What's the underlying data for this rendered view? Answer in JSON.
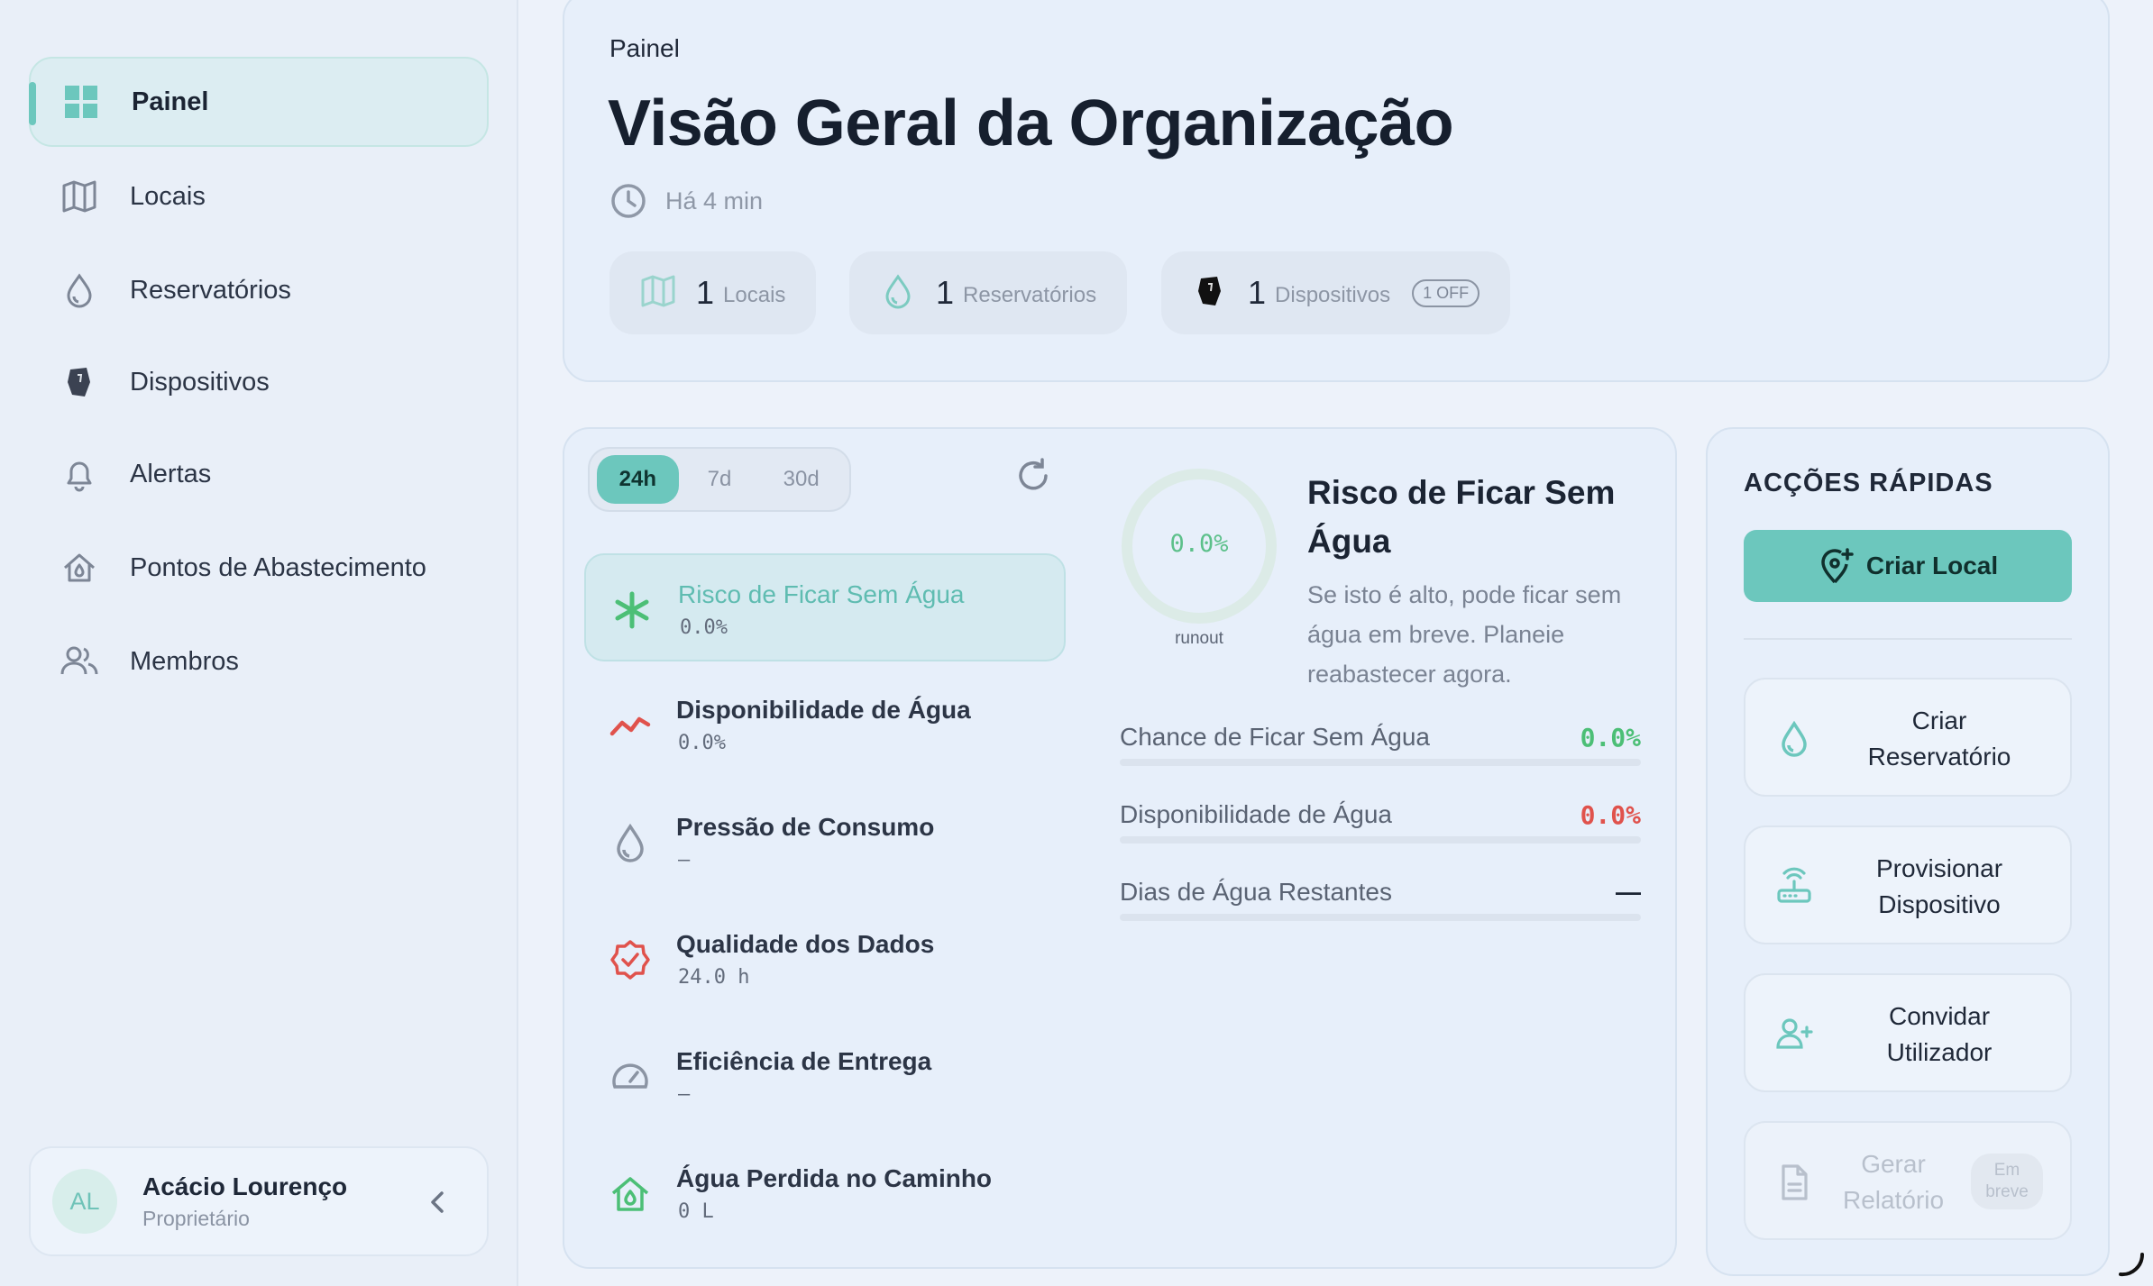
{
  "sidebar": {
    "items": [
      {
        "label": "Painel",
        "icon": "grid-icon",
        "active": true
      },
      {
        "label": "Locais",
        "icon": "map-icon"
      },
      {
        "label": "Reservatórios",
        "icon": "droplet-icon"
      },
      {
        "label": "Dispositivos",
        "icon": "device-icon"
      },
      {
        "label": "Alertas",
        "icon": "bell-icon"
      },
      {
        "label": "Pontos de Abastecimento",
        "icon": "house-icon"
      },
      {
        "label": "Membros",
        "icon": "users-icon"
      }
    ],
    "user": {
      "initials": "AL",
      "name": "Acácio Lourenço",
      "role": "Proprietário"
    }
  },
  "header": {
    "breadcrumb": "Painel",
    "title": "Visão Geral da Organização",
    "updated": "Há 4 min",
    "stats": [
      {
        "value": "1",
        "label": "Locais"
      },
      {
        "value": "1",
        "label": "Reservatórios"
      },
      {
        "value": "1",
        "label": "Dispositivos",
        "badge": "1 OFF"
      }
    ]
  },
  "metrics": {
    "ranges": [
      "24h",
      "7d",
      "30d"
    ],
    "selected_range": "24h",
    "items": [
      {
        "title": "Risco de Ficar Sem Água",
        "value": "0.0%",
        "icon": "asterisk-icon",
        "color": "#4cbf76"
      },
      {
        "title": "Disponibilidade de Água",
        "value": "0.0%",
        "icon": "trend-icon",
        "color": "#e0524c"
      },
      {
        "title": "Pressão de Consumo",
        "value": "—",
        "icon": "droplet-icon",
        "color": "#8b94a3"
      },
      {
        "title": "Qualidade dos Dados",
        "value": "24.0 h",
        "icon": "badge-check-icon",
        "color": "#e0524c"
      },
      {
        "title": "Eficiência de Entrega",
        "value": "—",
        "icon": "gauge-icon",
        "color": "#8b94a3"
      },
      {
        "title": "Água Perdida no Caminho",
        "value": "0 L",
        "icon": "house-drop-icon",
        "color": "#4cbf76"
      }
    ],
    "detail": {
      "gauge_value": "0.0%",
      "gauge_fraction": 0.0,
      "gauge_label": "runout",
      "title": "Risco de Ficar Sem Água",
      "description": "Se isto é alto, pode ficar sem água em breve. Planeie reabastecer agora.",
      "rows": [
        {
          "label": "Chance de Ficar Sem Água",
          "value": "0.0%",
          "color": "#4cbf76"
        },
        {
          "label": "Disponibilidade de Água",
          "value": "0.0%",
          "color": "#e0524c"
        },
        {
          "label": "Dias de Água Restantes",
          "value": "—",
          "color": "#1b2433"
        }
      ]
    }
  },
  "actions": {
    "title": "ACÇÕES RÁPIDAS",
    "primary": "Criar Local",
    "buttons": [
      {
        "label": "Criar Reservatório",
        "icon": "droplet-icon"
      },
      {
        "label": "Provisionar Dispositivo",
        "icon": "router-icon"
      },
      {
        "label": "Convidar Utilizador",
        "icon": "user-plus-icon"
      },
      {
        "label": "Gerar Relatório",
        "icon": "document-icon",
        "badge": "Em breve",
        "disabled": true
      }
    ]
  },
  "colors": {
    "accent": "#6cc7bd",
    "good": "#4cbf76",
    "bad": "#e0524c"
  }
}
